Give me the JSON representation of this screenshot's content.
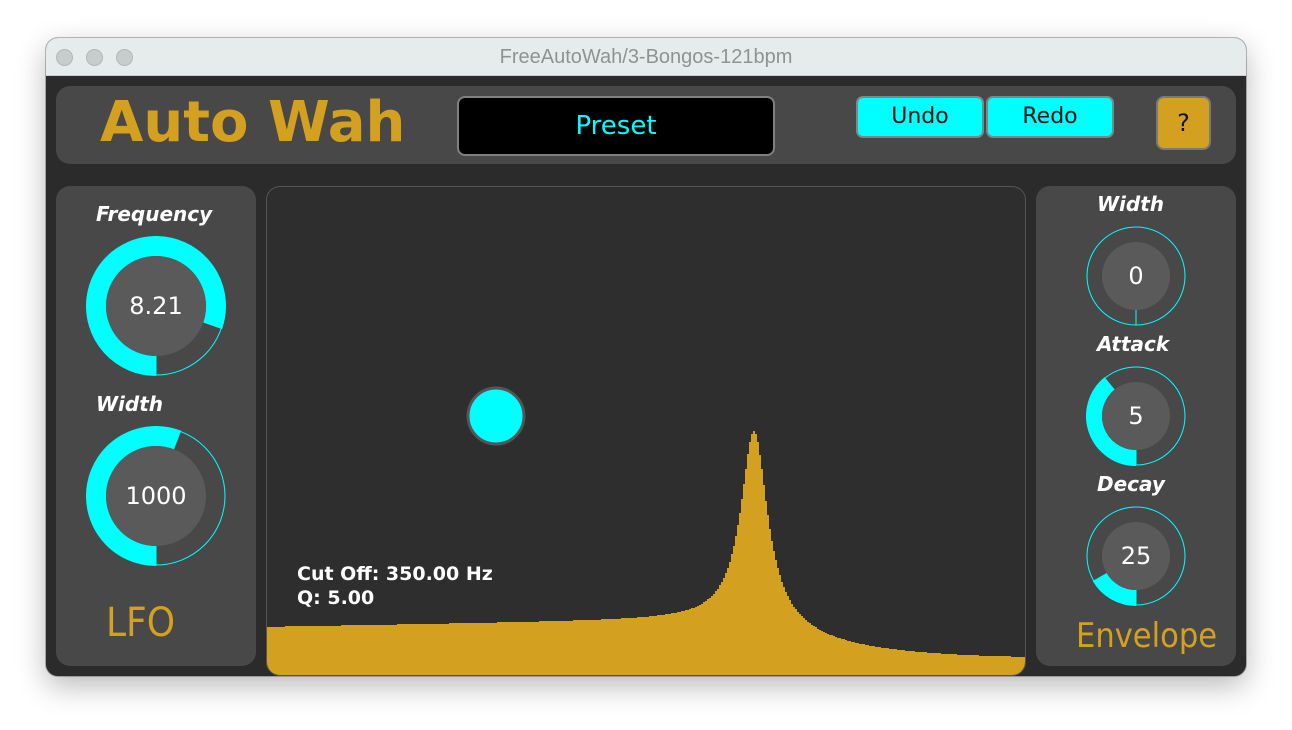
{
  "window": {
    "title": "FreeAutoWah/3-Bongos-121bpm"
  },
  "header": {
    "title": "Auto Wah",
    "preset_label": "Preset",
    "undo_label": "Undo",
    "redo_label": "Redo",
    "help_label": "?"
  },
  "lfo": {
    "section_label": "LFO",
    "frequency": {
      "label": "Frequency",
      "value": "8.21",
      "fraction": 0.82
    },
    "width": {
      "label": "Width",
      "value": "1000",
      "fraction": 0.57
    }
  },
  "envelope": {
    "section_label": "Envelope",
    "width": {
      "label": "Width",
      "value": "0",
      "fraction": 0.0
    },
    "attack": {
      "label": "Attack",
      "value": "5",
      "fraction": 0.4
    },
    "decay": {
      "label": "Decay",
      "value": "25",
      "fraction": 0.17
    }
  },
  "display": {
    "cutoff_text": "Cut Off: 350.00 Hz",
    "q_text": "Q: 5.00"
  },
  "colors": {
    "accent": "#00ffff",
    "brand": "#d4a020",
    "panel": "#484848",
    "background": "#2b2b2b"
  }
}
